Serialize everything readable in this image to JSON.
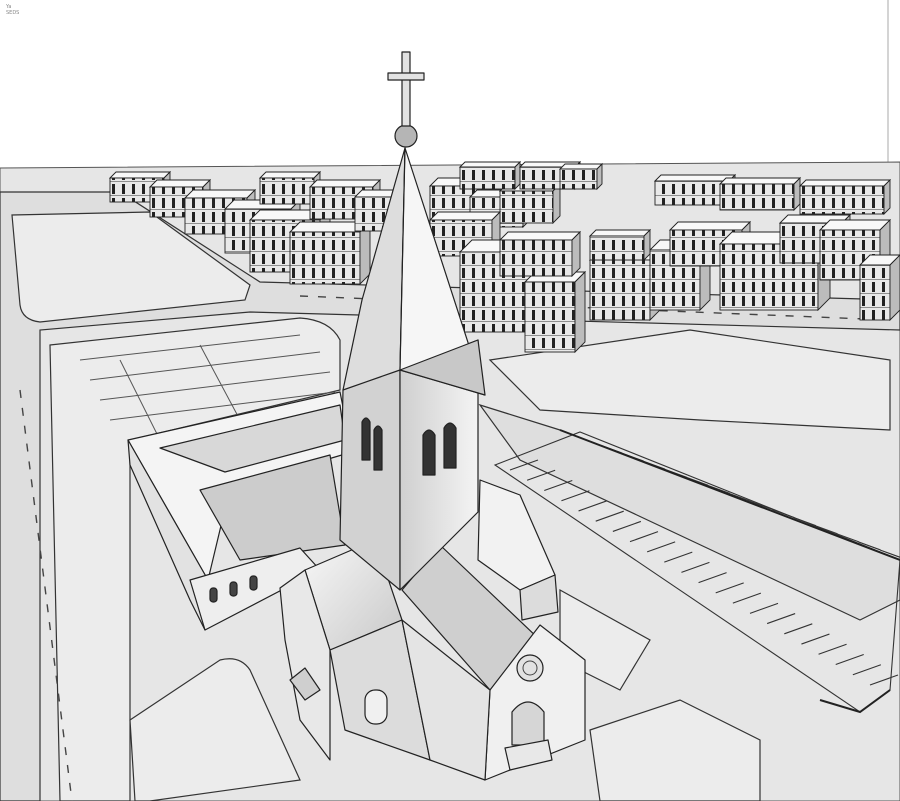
{
  "viewport": {
    "background": "#ffffff",
    "ground": "#e6e6e6",
    "ink": "#222222",
    "light": "#f6f6f6",
    "mid": "#cfcfcf",
    "dark": "#9a9a9a"
  },
  "corner_labels": {
    "axis": "Ya",
    "scale": "SEDS"
  }
}
